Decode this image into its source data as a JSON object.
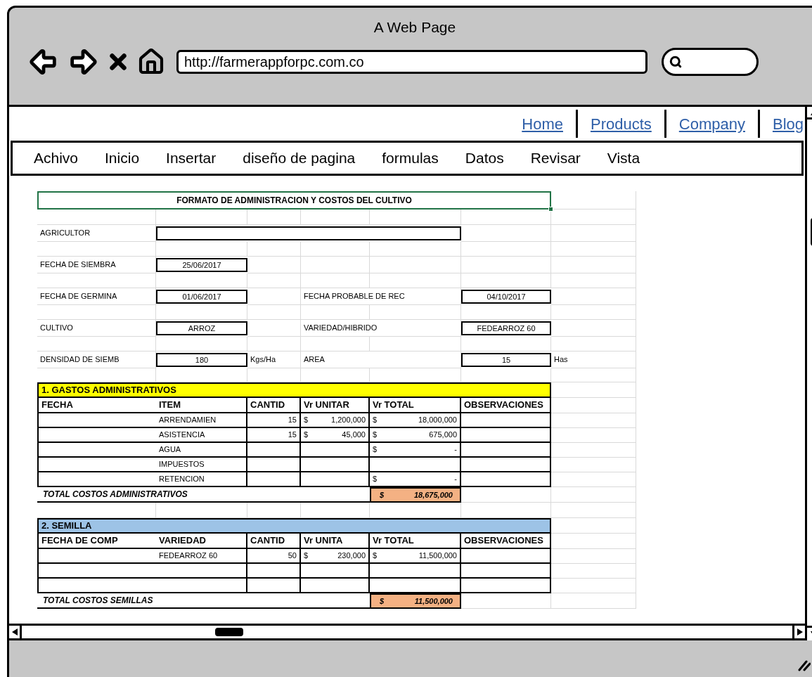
{
  "window": {
    "title": "A Web Page",
    "url": "http://farmerappforpc.com.co"
  },
  "links": [
    {
      "label": "Home"
    },
    {
      "label": "Products"
    },
    {
      "label": "Company"
    },
    {
      "label": "Blog"
    }
  ],
  "menu": [
    "Achivo",
    "Inicio",
    "Insertar",
    "diseño de pagina",
    "formulas",
    "Datos",
    "Revisar",
    "Vista"
  ],
  "sheet": {
    "title": {
      "text": "FORMATO DE ADMINISTRACION Y COSTOS DEL CULTIVO",
      "selected": true
    },
    "form_rows": [
      {
        "kind": "wide",
        "label": "AGRICULTOR"
      },
      {
        "kind": "pair",
        "label": "FECHA DE SIEMBRA",
        "value": "25/06/2017"
      },
      {
        "kind": "pair",
        "label": "FECHA DE GERMINA",
        "value": "01/06/2017",
        "right": {
          "label": "FECHA PROBABLE DE REC",
          "value": "04/10/2017"
        }
      },
      {
        "kind": "pair",
        "label": "CULTIVO",
        "value": "ARROZ",
        "right": {
          "label": "VARIEDAD/HIBRIDO",
          "value": "FEDEARROZ 60"
        }
      },
      {
        "kind": "pair",
        "label": "DENSIDAD DE SIEMB",
        "value": "180",
        "unit": "Kgs/Ha",
        "right": {
          "label": "AREA",
          "value": "15",
          "unit": "Has"
        }
      }
    ],
    "sections": [
      {
        "title": "1. GASTOS ADMINISTRATIVOS",
        "color": "#ffff00",
        "header": [
          "FECHA",
          "ITEM",
          "CANTID",
          "Vr UNITAR",
          "Vr TOTAL",
          "OBSERVACIONES"
        ],
        "rows": [
          {
            "kind": "entry",
            "item": "ARRENDAMIEN",
            "qty": "15",
            "unit_price": {
              "currency": "$",
              "value": "1,200,000"
            },
            "total": {
              "currency": "$",
              "value": "18,000,000"
            }
          },
          {
            "kind": "entry",
            "item": "ASISTENCIA",
            "qty": "15",
            "unit_price": {
              "currency": "$",
              "value": "45,000"
            },
            "total": {
              "currency": "$",
              "value": "675,000"
            }
          },
          {
            "kind": "entry",
            "item": "AGUA",
            "total": {
              "currency": "$",
              "value": "-"
            }
          },
          {
            "kind": "entry",
            "item": "IMPUESTOS"
          },
          {
            "kind": "entry",
            "item": "RETENCION",
            "total": {
              "currency": "$",
              "value": "-"
            }
          }
        ],
        "total": {
          "label": "TOTAL COSTOS ADMINISTRATIVOS",
          "currency": "$",
          "value": "18,675,000"
        }
      },
      {
        "title": "2. SEMILLA",
        "color": "#9dc3e6",
        "header": [
          "FECHA DE COMP",
          "VARIEDAD",
          "CANTID",
          "Vr UNITA",
          "Vr TOTAL",
          "OBSERVACIONES"
        ],
        "rows": [
          {
            "kind": "entry",
            "item": "FEDEARROZ 60",
            "qty": "50",
            "unit_price": {
              "currency": "$",
              "value": "230,000"
            },
            "total": {
              "currency": "$",
              "value": "11,500,000"
            }
          },
          {
            "kind": "blank"
          },
          {
            "kind": "blank"
          }
        ],
        "total": {
          "label": "TOTAL COSTOS SEMILLAS",
          "currency": "$",
          "value": "11,500,000"
        }
      }
    ]
  }
}
